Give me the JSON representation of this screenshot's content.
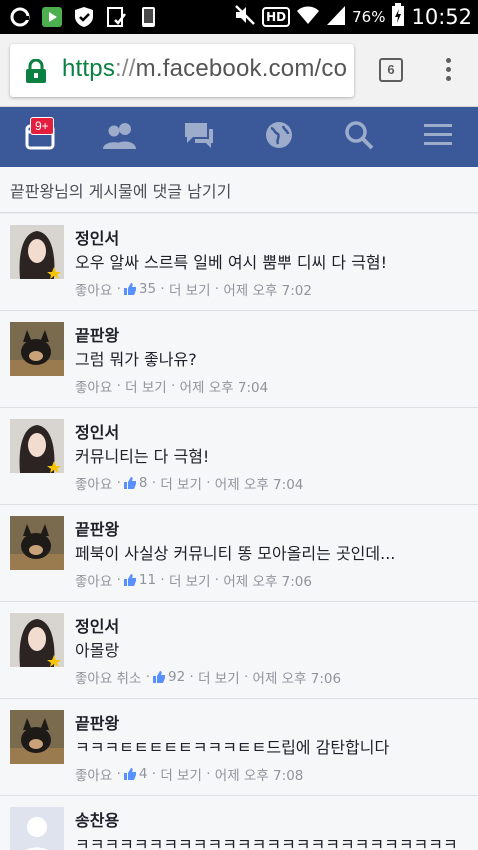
{
  "status_bar": {
    "battery": "76%",
    "clock": "10:52",
    "hd": "HD"
  },
  "browser": {
    "url_scheme": "https",
    "url_sep": "://",
    "url_host": "m.facebook.com/co",
    "tab_count": "6"
  },
  "nav": {
    "notification_badge": "9+"
  },
  "header": {
    "title": "끝판왕님의 게시물에 댓글 남기기"
  },
  "comments": [
    {
      "author": "정인서",
      "text": "오우 알싸 스르륵 일베 여시 뿜뿌 디씨 다 극혐!",
      "like": "좋아요",
      "dot1": "·",
      "likes": "35",
      "dot2": "·",
      "more": "더 보기",
      "dot3": "·",
      "time": "어제 오후 7:02"
    },
    {
      "author": "끝판왕",
      "text": "그럼 뭐가 좋나유?",
      "like": "좋아요",
      "dot2": "·",
      "more": "더 보기",
      "dot3": "·",
      "time": "어제 오후 7:04"
    },
    {
      "author": "정인서",
      "text": "커뮤니티는 다 극혐!",
      "like": "좋아요",
      "dot1": "·",
      "likes": "8",
      "dot2": "·",
      "more": "더 보기",
      "dot3": "·",
      "time": "어제 오후 7:04"
    },
    {
      "author": "끝판왕",
      "text": "페북이 사실상 커뮤니티 똥 모아올리는 곳인데...",
      "like": "좋아요",
      "dot1": "·",
      "likes": "11",
      "dot2": "·",
      "more": "더 보기",
      "dot3": "·",
      "time": "어제 오후 7:06"
    },
    {
      "author": "정인서",
      "text": "아몰랑",
      "like": "좋아요 취소",
      "dot1": "·",
      "likes": "92",
      "dot2": "·",
      "more": "더 보기",
      "dot3": "·",
      "time": "어제 오후 7:06"
    },
    {
      "author": "끝판왕",
      "text": "ㅋㅋㅋㅌㅌㅌㅌㅌㅋㅋㅋㅌㅌ드립에 감탄합니다",
      "like": "좋아요",
      "dot1": "·",
      "likes": "4",
      "dot2": "·",
      "more": "더 보기",
      "dot3": "·",
      "time": "어제 오후 7:08"
    },
    {
      "author": "송찬용",
      "text": "ㅋㅋㅋㅋㅋㅋㅋㅋㅋㅋㅋㅋㅋㅋㅋㅋㅋㅋㅋㅋㅋㅋㅋㅋㅋㅋ"
    }
  ],
  "colors": {
    "fb_blue": "#3b5998",
    "url_green": "#0b8043",
    "badge_red": "#e41e3f"
  },
  "icons": [
    "whatsapp-icon",
    "play-store-icon",
    "shield-icon",
    "clipboard-check-icon",
    "phone-icon",
    "mute-icon",
    "hd-voice-icon",
    "wifi-icon",
    "signal-icon",
    "battery-icon",
    "lock-icon",
    "menu-kebab-icon",
    "notifications-icon",
    "friends-icon",
    "messages-icon",
    "globe-icon",
    "search-icon",
    "hamburger-icon",
    "thumbs-up-icon"
  ]
}
